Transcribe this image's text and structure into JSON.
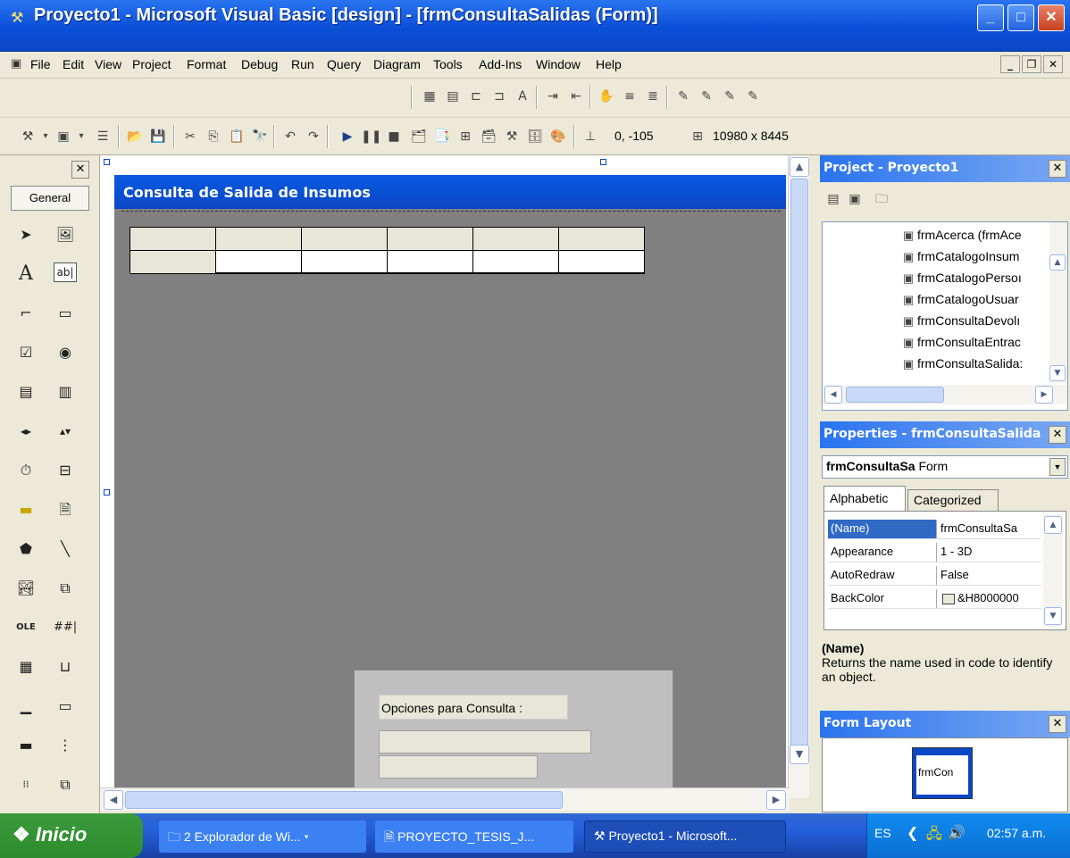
{
  "window": {
    "title": "Proyecto1 - Microsoft Visual Basic [design] - [frmConsultaSalidas (Form)]"
  },
  "menu": [
    "File",
    "Edit",
    "View",
    "Project",
    "Format",
    "Debug",
    "Run",
    "Query",
    "Diagram",
    "Tools",
    "Add-Ins",
    "Window",
    "Help"
  ],
  "toolbar": {
    "position": "0, -105",
    "size": "10980 x 8445"
  },
  "toolbox": {
    "tab": "General"
  },
  "form": {
    "caption": "Consulta de Salida de Insumos",
    "frame_label": "Opciones para Consulta :"
  },
  "project": {
    "title": "Project - Proyecto1",
    "items": [
      "frmAcerca (frmAce",
      "frmCatalogoInsum",
      "frmCatalogoPersoı",
      "frmCatalogoUsuar",
      "frmConsultaDevolı",
      "frmConsultaEntrac",
      "frmConsultaSalida:"
    ]
  },
  "properties": {
    "title": "Properties - frmConsultaSalida",
    "object": "frmConsultaSa",
    "object_type": "Form",
    "tabs": [
      "Alphabetic",
      "Categorized"
    ],
    "rows": [
      {
        "name": "(Name)",
        "value": "frmConsultaSa"
      },
      {
        "name": "Appearance",
        "value": "1 - 3D"
      },
      {
        "name": "AutoRedraw",
        "value": "False"
      },
      {
        "name": "BackColor",
        "value": "&H8000000"
      }
    ],
    "desc_title": "(Name)",
    "desc_text": "Returns the name used in code to identify an object."
  },
  "form_layout": {
    "title": "Form Layout",
    "preview": "frmCon"
  },
  "taskbar": {
    "start": "Inicio",
    "tasks": [
      "2 Explorador de Wi...",
      "PROYECTO_TESIS_J...",
      "Proyecto1 - Microsoft..."
    ],
    "lang": "ES",
    "clock": "02:57 a.m."
  }
}
